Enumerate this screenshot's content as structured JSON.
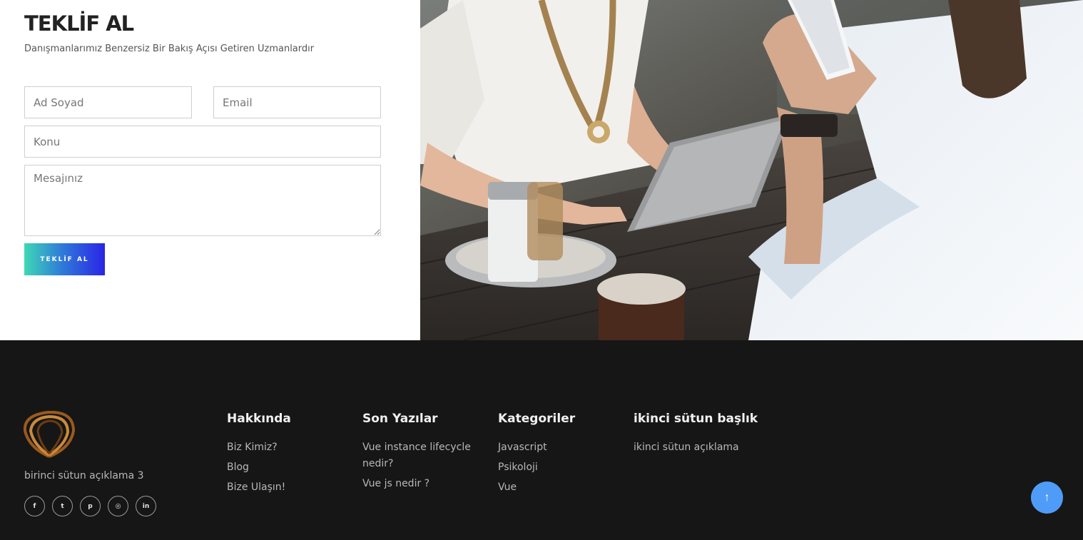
{
  "quote_form": {
    "title": "TEKLİF AL",
    "subtitle": "Danışmanlarımız Benzersiz Bir Bakış Açısı Getiren Uzmanlardır",
    "name_placeholder": "Ad Soyad",
    "email_placeholder": "Email",
    "subject_placeholder": "Konu",
    "message_placeholder": "Mesajınız",
    "submit_label": "TEKLİF AL"
  },
  "footer": {
    "description": "birinci sütun açıklama 3",
    "social_icons": [
      {
        "name": "facebook-icon",
        "glyph": "f"
      },
      {
        "name": "twitter-icon",
        "glyph": "t"
      },
      {
        "name": "pinterest-icon",
        "glyph": "p"
      },
      {
        "name": "instagram-icon",
        "glyph": "◎"
      },
      {
        "name": "linkedin-icon",
        "glyph": "in"
      }
    ],
    "about": {
      "title": "Hakkında",
      "links": [
        "Biz Kimiz?",
        "Blog",
        "Bize Ulaşın!"
      ]
    },
    "recent_posts": {
      "title": "Son Yazılar",
      "links": [
        "Vue instance lifecycle nedir?",
        "Vue js nedir ?"
      ]
    },
    "categories": {
      "title": "Kategoriler",
      "links": [
        "Javascript",
        "Psikoloji",
        "Vue"
      ]
    },
    "second_column": {
      "title": "ikinci sütun başlık",
      "text": "ikinci sütun açıklama"
    }
  },
  "scroll_top_icon": "arrow-up-icon",
  "colors": {
    "footer_bg": "#161616",
    "scroll_button": "#4f9cf8",
    "gradient_start": "#3ed8b6",
    "gradient_end": "#2a24e6"
  }
}
